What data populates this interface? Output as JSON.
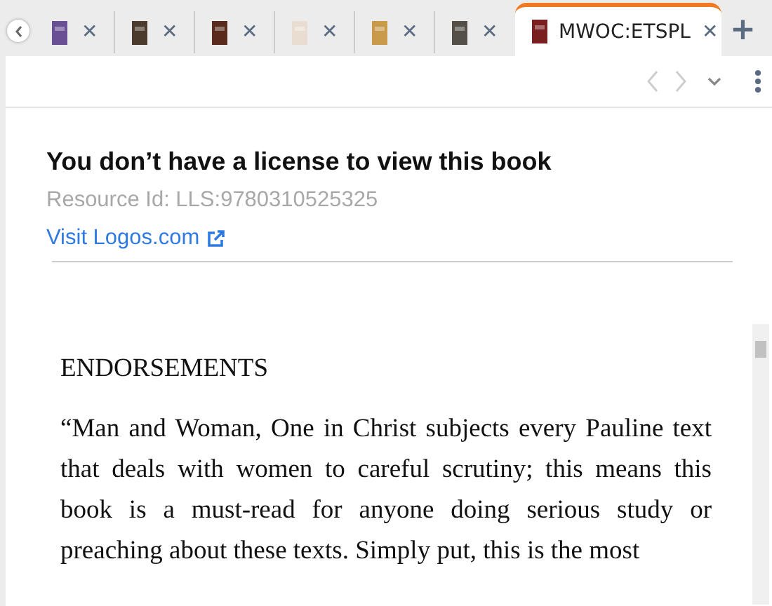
{
  "tabs": [
    {
      "color": "#6a4f94",
      "selected": false,
      "close": "✕"
    },
    {
      "color": "#4a3b2c",
      "selected": false,
      "close": "✕"
    },
    {
      "color": "#5a2b1c",
      "selected": false,
      "close": "✕"
    },
    {
      "color": "#e8ddd0",
      "selected": false,
      "close": "✕"
    },
    {
      "color": "#c89a4a",
      "selected": false,
      "close": "✕"
    },
    {
      "color": "#545048",
      "selected": false,
      "close": "✕"
    },
    {
      "color": "#7a1f1f",
      "selected": true,
      "label": "MWOC:ETSPL",
      "close": "✕"
    }
  ],
  "new_tab": "+",
  "notice": {
    "title": "You don’t have a license to view this book",
    "resource_id": "Resource Id: LLS:9780310525325",
    "link": "Visit Logos.com"
  },
  "document": {
    "heading": "ENDORSEMENTS",
    "paragraph": "“Man and Woman, One in Christ subjects every Pauline text that deals with women to careful scrutiny; this means this book is a must-read for anyone doing serious study or preaching about these texts. Simply put, this is the most"
  }
}
